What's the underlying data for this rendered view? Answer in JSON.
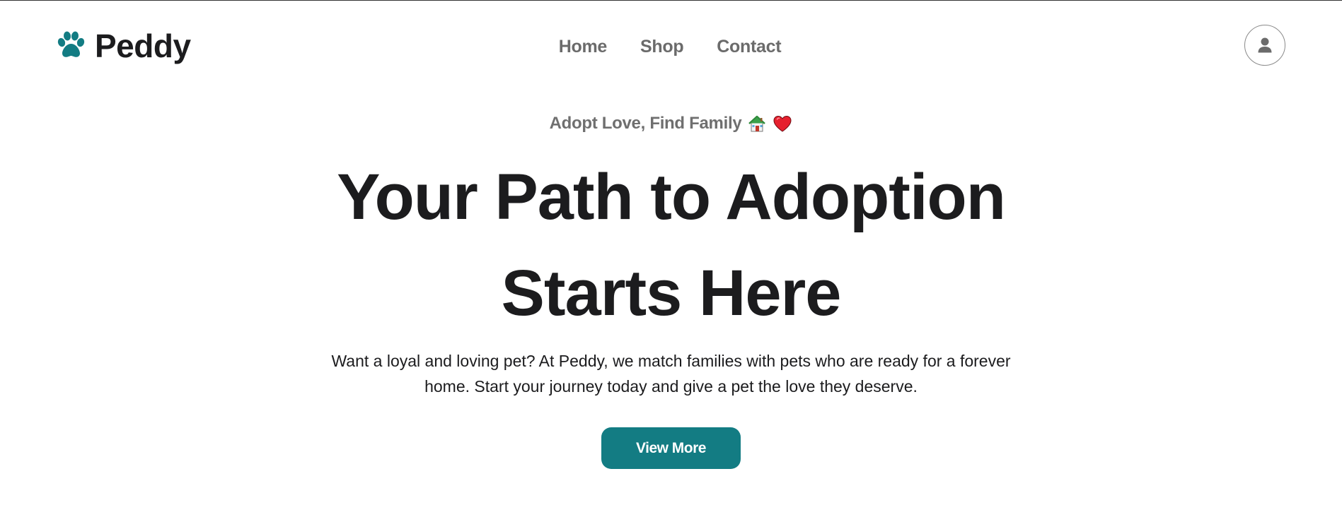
{
  "brand": {
    "name": "Peddy",
    "logo_icon": "paw-icon",
    "accent_color": "#137c83"
  },
  "nav": {
    "items": [
      {
        "label": "Home"
      },
      {
        "label": "Shop"
      },
      {
        "label": "Contact"
      }
    ]
  },
  "account": {
    "icon": "user-icon"
  },
  "hero": {
    "tagline": "Adopt Love, Find Family",
    "tagline_icons": [
      "house-icon",
      "heart-icon"
    ],
    "headline_line1": "Your Path to Adoption",
    "headline_line2": "Starts Here",
    "description": "Want a loyal and loving pet? At Peddy, we match families with pets who are ready for a forever home. Start your journey today and give a pet the love they deserve.",
    "cta_label": "View More"
  },
  "colors": {
    "accent": "#137c83",
    "text": "#1c1c1e",
    "muted": "#6b6b6b",
    "background": "#ffffff"
  }
}
